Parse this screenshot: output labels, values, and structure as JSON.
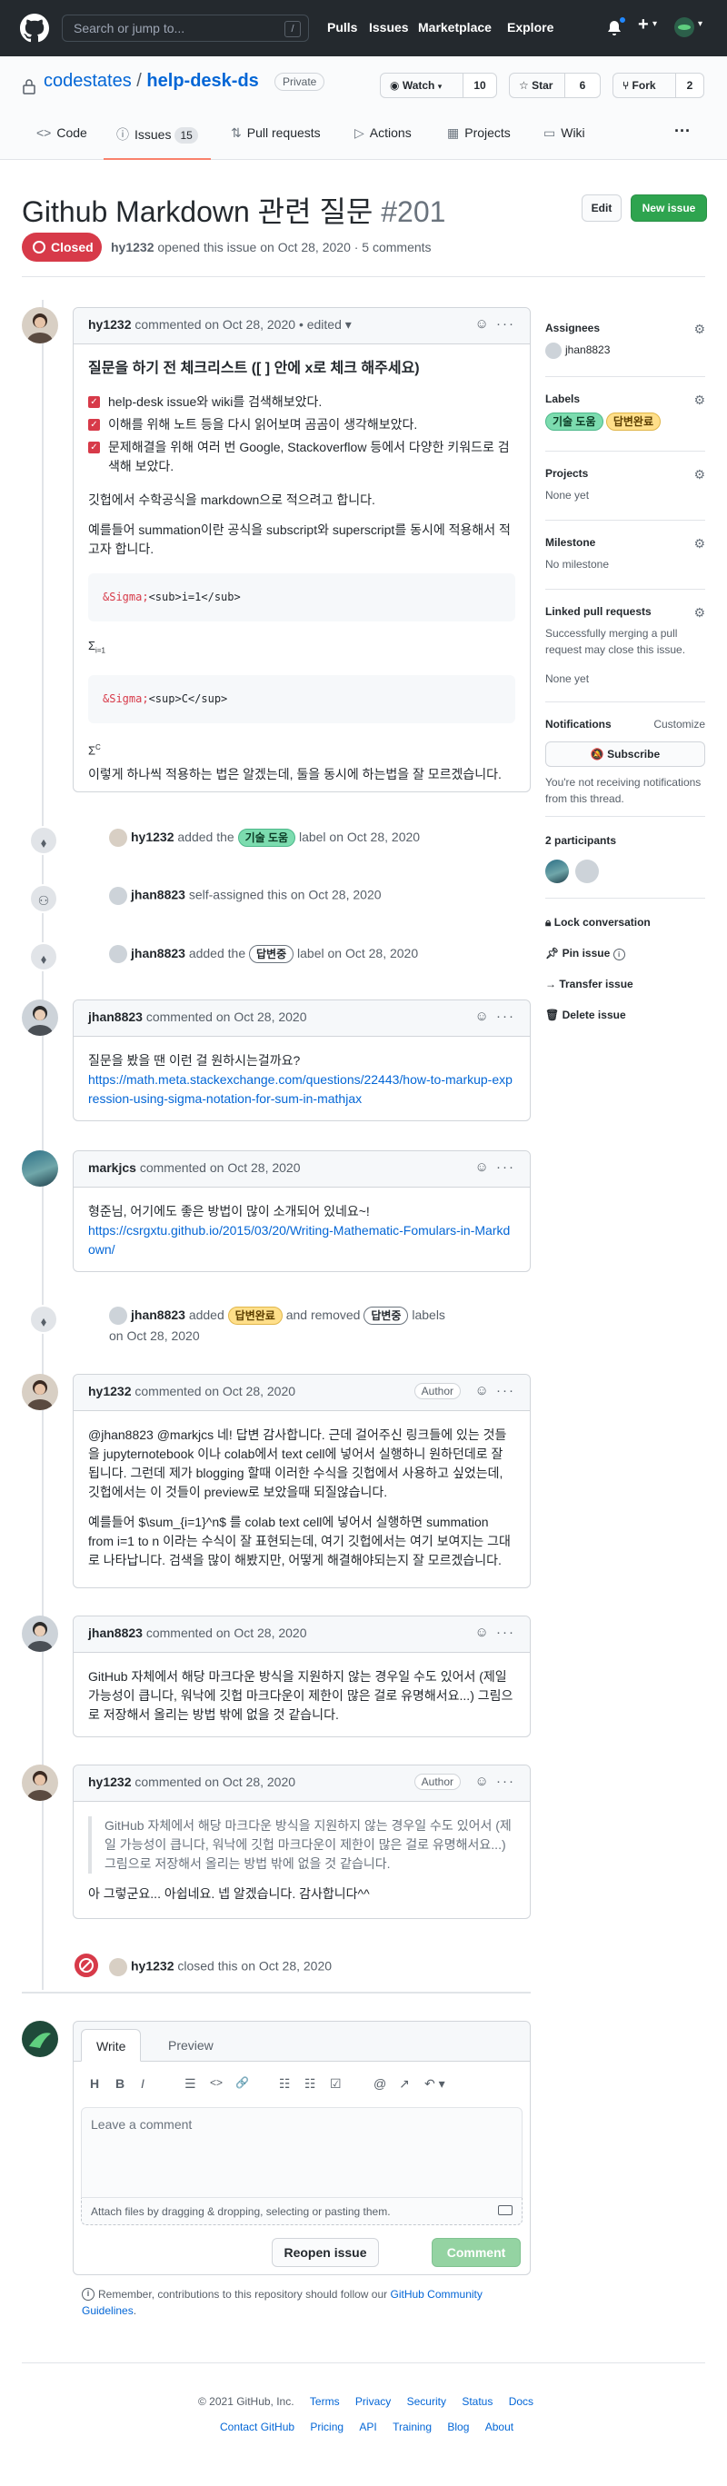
{
  "header": {
    "search_placeholder": "Search or jump to...",
    "slash_key": "/",
    "nav": [
      "Pulls",
      "Issues",
      "Marketplace",
      "Explore"
    ],
    "plus": "+",
    "caret": "▾"
  },
  "repo": {
    "owner": "codestates",
    "separator": "/",
    "name": "help-desk-ds",
    "visibility": "Private",
    "watch_label": "Watch",
    "watch_count": "10",
    "star_label": "Star",
    "star_count": "6",
    "fork_label": "Fork",
    "fork_count": "2"
  },
  "tabs": [
    {
      "label": "Code",
      "icon": "<>"
    },
    {
      "label": "Issues",
      "count": "15",
      "icon": "ⓘ"
    },
    {
      "label": "Pull requests",
      "icon": "⇅"
    },
    {
      "label": "Actions",
      "icon": "▷"
    },
    {
      "label": "Projects",
      "icon": "▦"
    },
    {
      "label": "Wiki",
      "icon": "▭"
    }
  ],
  "tabs_more": "···",
  "issue": {
    "title": "Github Markdown 관련 질문",
    "number": "#201",
    "edit_label": "Edit",
    "new_issue_label": "New issue",
    "state": "Closed",
    "meta_author": "hy1232",
    "meta_rest": "opened this issue on Oct 28, 2020 · 5 comments"
  },
  "comment1": {
    "author": "hy1232",
    "header_rest": "commented on Oct 28, 2020",
    "edited": "• edited ▾",
    "heading": "질문을 하기 전 체크리스트 ([ ] 안에 x로 체크 해주세요)",
    "checks": [
      "help-desk issue와 wiki를 검색해보았다.",
      "이해를 위해 노트 등을 다시 읽어보며 곰곰이 생각해보았다.",
      "문제해결을 위해 여러 번 Google, Stackoverflow 등에서 다양한 키워드로 검색해 보았다."
    ],
    "p1": "깃헙에서 수학공식을 markdown으로 적으려고 합니다.",
    "p2": "예를들어 summation이란 공식을 subscript와 superscript를 동시에 적용해서 적고자 합니다.",
    "code1_entity": "&Sigma;",
    "code1_rest": "<sub>i=1</sub>",
    "render1_main": "Σ",
    "render1_sub": "i=1",
    "code2_entity": "&Sigma;",
    "code2_rest": "<sup>C</sup>",
    "render2_main": "Σ",
    "render2_sup": "C",
    "p3": "이렇게 하나씩 적용하는 법은 알겠는데, 둘을 동시에 하는법을 잘 모르겠습니다."
  },
  "events": {
    "e1_user": "hy1232",
    "e1_mid": "added the",
    "e1_label": "기술 도움",
    "e1_end": "label on Oct 28, 2020",
    "e2_user": "jhan8823",
    "e2_rest": "self-assigned this on Oct 28, 2020",
    "e3_user": "jhan8823",
    "e3_mid": "added the",
    "e3_label": "답변중",
    "e3_end": "label on Oct 28, 2020"
  },
  "comment2": {
    "author": "jhan8823",
    "header_rest": "commented on Oct 28, 2020",
    "text": "질문을 봤을 땐 이런 걸 원하시는걸까요?",
    "link": "https://math.meta.stackexchange.com/questions/22443/how-to-markup-expression-using-sigma-notation-for-sum-in-mathjax"
  },
  "comment3": {
    "author": "markjcs",
    "header_rest": "commented on Oct 28, 2020",
    "text": "형준님, 어기에도 좋은 방법이 많이 소개되어 있네요~!",
    "link": "https://csrgxtu.github.io/2015/03/20/Writing-Mathematic-Fomulars-in-Markdown/"
  },
  "event4": {
    "user": "jhan8823",
    "mid1": "added",
    "label_added": "답변완료",
    "mid2": "and removed",
    "label_removed": "답변중",
    "end": "labels",
    "date": "on Oct 28, 2020"
  },
  "comment4": {
    "author": "hy1232",
    "header_rest": "commented on Oct 28, 2020",
    "badge": "Author",
    "p1": "@jhan8823 @markjcs 네! 답변 감사합니다. 근데 걸어주신 링크들에 있는 것들을 jupyternotebook 이나 colab에서 text cell에 넣어서 실행하니 원하던데로 잘 됩니다. 그런데 제가 blogging 할때 이러한 수식을 깃헙에서 사용하고 싶었는데, 깃헙에서는 이 것들이 preview로 보았을때 되질않습니다.",
    "p2": "예를들어 $\\sum_{i=1}^n$ 를 colab text cell에 넣어서 실행하면 summation from i=1 to n 이라는 수식이 잘 표현되는데, 여기 깃헙에서는 여기 보여지는 그대로 나타납니다. 검색을 많이 해봤지만, 어떻게 해결해야되는지 잘 모르겠습니다."
  },
  "comment5": {
    "author": "jhan8823",
    "header_rest": "commented on Oct 28, 2020",
    "text": "GitHub 자체에서 해당 마크다운 방식을 지원하지 않는 경우일 수도 있어서 (제일 가능성이 큽니다, 워낙에 깃헙 마크다운이 제한이 많은 걸로 유명해서요...) 그림으로 저장해서 올리는 방법 밖에 없을 것 같습니다."
  },
  "comment6": {
    "author": "hy1232",
    "header_rest": "commented on Oct 28, 2020",
    "badge": "Author",
    "quote": "GitHub 자체에서 해당 마크다운 방식을 지원하지 않는 경우일 수도 있어서 (제일 가능성이 큽니다, 워낙에 깃헙 마크다운이 제한이 많은 걸로 유명해서요...) 그림으로 저장해서 올리는 방법 밖에 없을 것 같습니다.",
    "text": "아 그렇군요... 아쉽네요. 넵 알겠습니다. 감사합니다^^"
  },
  "closed_event": {
    "user": "hy1232",
    "rest": "closed this on Oct 28, 2020"
  },
  "editor": {
    "tab_write": "Write",
    "tab_preview": "Preview",
    "toolbar": [
      "H",
      "B",
      "I",
      "☰",
      "<>",
      "🔗",
      "☷",
      "☷",
      "☑",
      "@",
      "↗",
      "↶ ▾"
    ],
    "placeholder": "Leave a comment",
    "attach_hint": "Attach files by dragging & dropping, selecting or pasting them.",
    "reopen_label": "Reopen issue",
    "comment_label": "Comment"
  },
  "guidelines": {
    "text": "Remember, contributions to this repository should follow our",
    "link": "GitHub Community Guidelines",
    "end": "."
  },
  "sidebar": {
    "assignees_title": "Assignees",
    "assignee": "jhan8823",
    "labels_title": "Labels",
    "labels": [
      "기술 도움",
      "답변완료"
    ],
    "projects_title": "Projects",
    "projects_value": "None yet",
    "milestone_title": "Milestone",
    "milestone_value": "No milestone",
    "linked_title": "Linked pull requests",
    "linked_desc": "Successfully merging a pull request may close this issue.",
    "linked_value": "None yet",
    "notifications_title": "Notifications",
    "customize": "Customize",
    "subscribe_label": "Subscribe",
    "notif_desc": "You're not receiving notifications from this thread.",
    "participants_title": "2 participants",
    "lock": "Lock conversation",
    "pin": "Pin issue",
    "transfer": "Transfer issue",
    "delete": "Delete issue"
  },
  "footer": {
    "copyright": "© 2021 GitHub, Inc.",
    "row1": [
      "Terms",
      "Privacy",
      "Security",
      "Status",
      "Docs"
    ],
    "row2": [
      "Contact GitHub",
      "Pricing",
      "API",
      "Training",
      "Blog",
      "About"
    ]
  },
  "colors": {
    "closed_red": "#d73a49",
    "primary_green": "#2ea44f",
    "link_blue": "#0366d6",
    "header_dark": "#24292e"
  }
}
